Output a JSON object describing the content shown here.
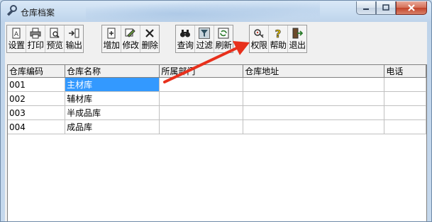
{
  "window": {
    "title": "仓库档案",
    "accent_close": "#c2432a"
  },
  "toolbar": {
    "groups": [
      [
        {
          "label": "设置",
          "icon": "settings-doc-icon"
        },
        {
          "label": "打印",
          "icon": "printer-icon"
        },
        {
          "label": "预览",
          "icon": "preview-icon"
        },
        {
          "label": "输出",
          "icon": "export-icon"
        }
      ],
      [
        {
          "label": "增加",
          "icon": "add-icon"
        },
        {
          "label": "修改",
          "icon": "edit-icon"
        },
        {
          "label": "删除",
          "icon": "delete-icon"
        }
      ],
      [
        {
          "label": "查询",
          "icon": "binoculars-icon"
        },
        {
          "label": "过滤",
          "icon": "filter-icon"
        },
        {
          "label": "刷新",
          "icon": "refresh-icon"
        }
      ],
      [
        {
          "label": "权限",
          "icon": "permission-icon"
        },
        {
          "label": "帮助",
          "icon": "help-icon"
        },
        {
          "label": "退出",
          "icon": "exit-icon"
        }
      ]
    ]
  },
  "grid": {
    "columns": [
      "仓库编码",
      "仓库名称",
      "所属部门",
      "仓库地址",
      "电话"
    ],
    "rows": [
      [
        "001",
        "主材库",
        "",
        "",
        ""
      ],
      [
        "002",
        "辅材库",
        "",
        "",
        ""
      ],
      [
        "003",
        "半成品库",
        "",
        "",
        ""
      ],
      [
        "004",
        "成品库",
        "",
        "",
        ""
      ]
    ],
    "selected_color": "#3399ff"
  },
  "annotation": {
    "arrow_color": "#e8301c",
    "target": "权限"
  }
}
